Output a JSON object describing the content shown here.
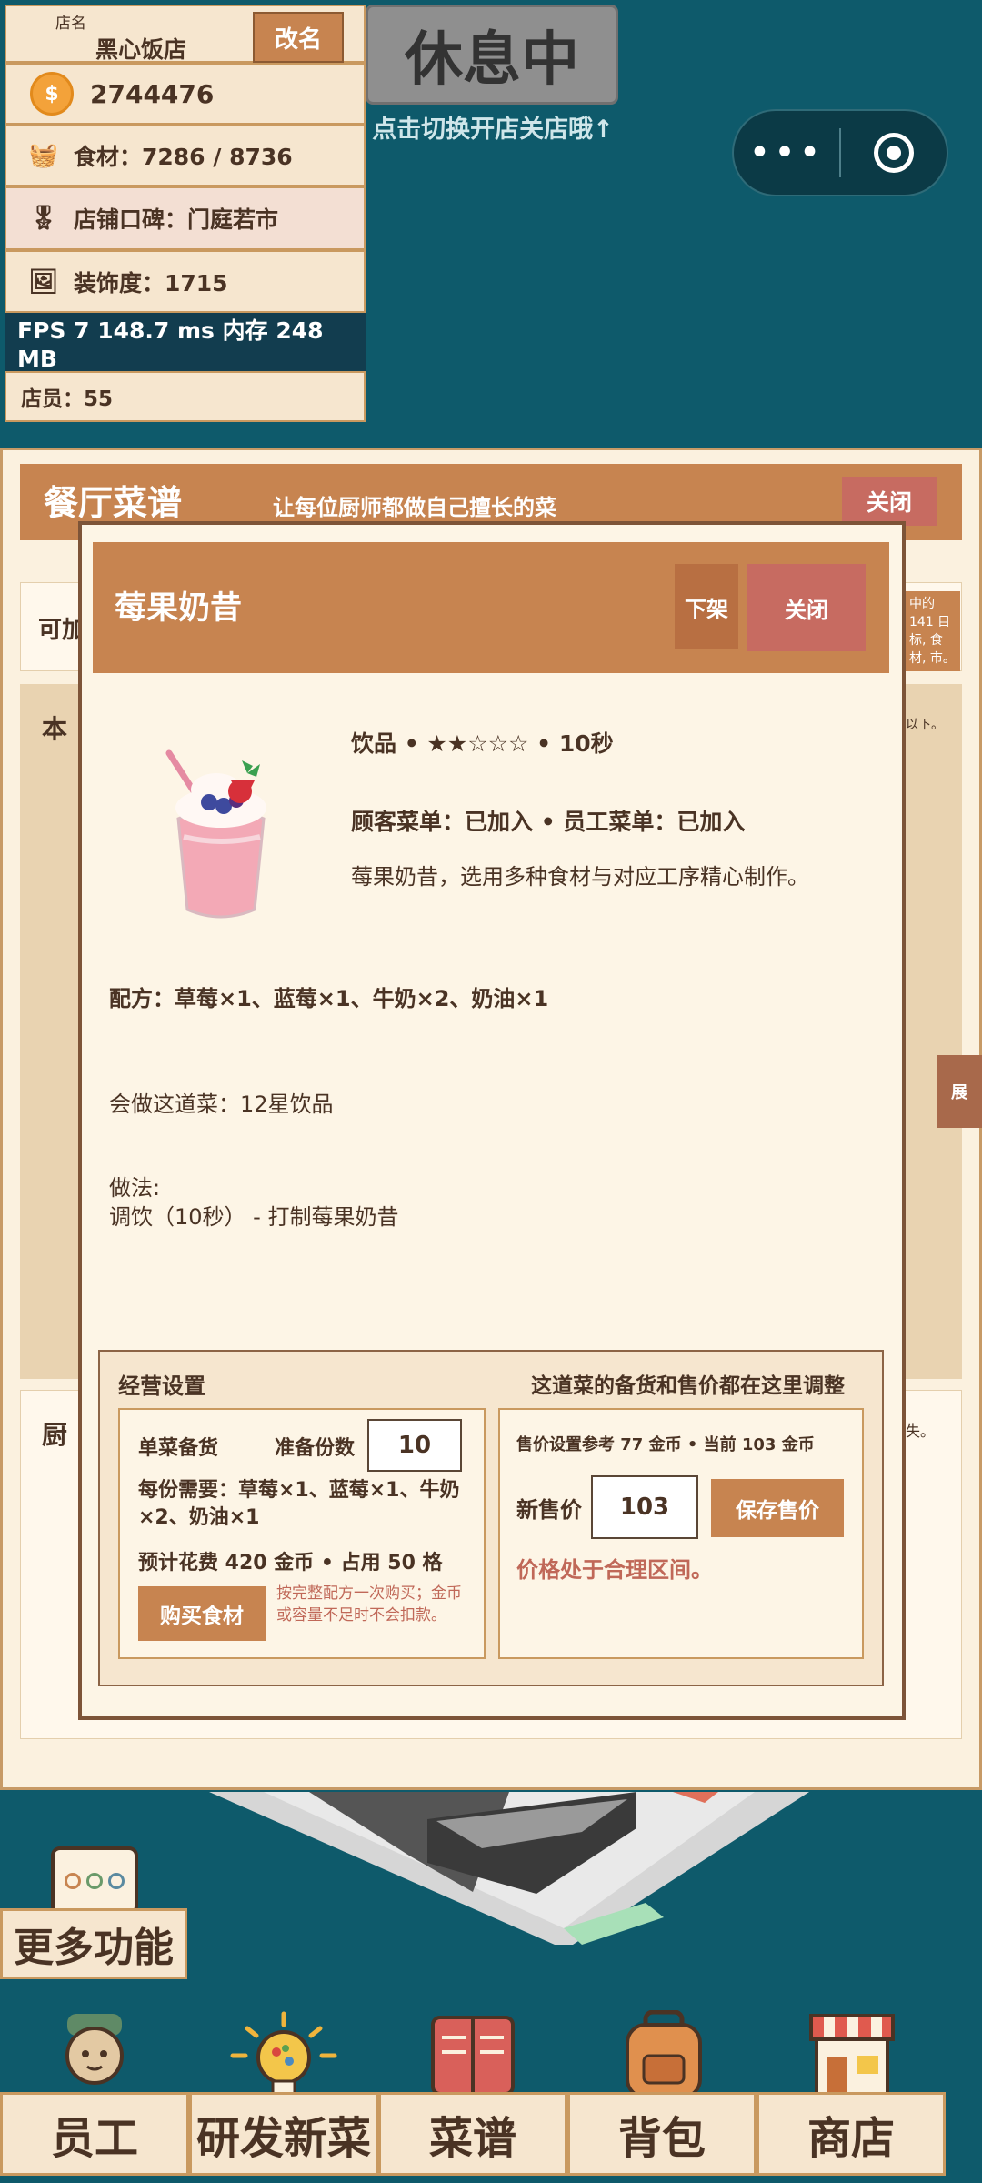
{
  "shop": {
    "name_label": "店名",
    "name": "黑心饭店",
    "rename": "改名",
    "coins": "2744476",
    "ingredients": "食材：7286 / 8736",
    "reputation": "店铺口碑：门庭若市",
    "decor": "装饰度：1715",
    "fps": "FPS 7   148.7 ms   内存 248 MB",
    "staff": "店员：55"
  },
  "status": {
    "state": "休息中",
    "hint": "点击切换开店关店哦↑"
  },
  "capsule": {
    "more_icon": "dots-icon",
    "close_icon": "target-icon"
  },
  "menu_panel": {
    "title": "餐厅菜谱",
    "subtitle": "让每位厨师都做自己擅长的菜",
    "close": "关闭",
    "strip_label": "可加",
    "strip_note": "中的 141 目标, 食材, 市。",
    "section1_label": "本",
    "section1_note": "以下。",
    "section2_label": "厨",
    "section2_note": "失。",
    "side_tab": "展"
  },
  "dish": {
    "name": "莓果奶昔",
    "delist": "下架",
    "close": "关闭",
    "meta": "饮品 • ★★☆☆☆ • 10秒",
    "menus": "顾客菜单：已加入   •   员工菜单：已加入",
    "description": "莓果奶昔，选用多种食材与对应工序精心制作。",
    "recipe": "配方：草莓×1、蓝莓×1、牛奶×2、奶油×1",
    "chef_req": "会做这道菜：12星饮品",
    "method_title": "做法:",
    "method": "调饮（10秒） - 打制莓果奶昔"
  },
  "business": {
    "title": "经营设置",
    "subtitle": "这道菜的备货和售价都在这里调整",
    "stock_title": "单菜备货",
    "prep_label": "准备份数",
    "prep_value": "10",
    "need": "每份需要：草莓×1、蓝莓×1、牛奶×2、奶油×1",
    "cost": "预计花费 420 金币 • 占用 50 格",
    "buy": "购买食材",
    "buy_note": "按完整配方一次购买；金币或容量不足时不会扣款。",
    "price_ref": "售价设置参考 77 金币 • 当前 103 金币",
    "new_price_label": "新售价",
    "new_price": "103",
    "save": "保存售价",
    "price_status": "价格处于合理区间。"
  },
  "bottom": {
    "more": "更多功能",
    "nav": [
      "员工",
      "研发新菜",
      "菜谱",
      "背包",
      "商店"
    ]
  }
}
